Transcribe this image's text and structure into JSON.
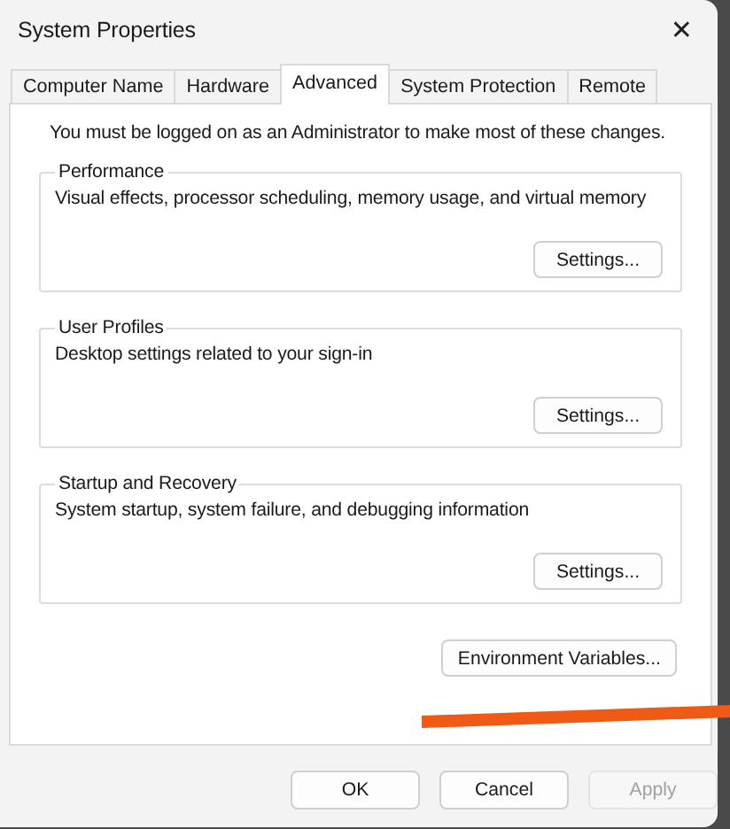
{
  "window": {
    "title": "System Properties",
    "close": "✕"
  },
  "tabs": [
    {
      "label": "Computer Name",
      "selected": false
    },
    {
      "label": "Hardware",
      "selected": false
    },
    {
      "label": "Advanced",
      "selected": true
    },
    {
      "label": "System Protection",
      "selected": false
    },
    {
      "label": "Remote",
      "selected": false
    }
  ],
  "notice": "You must be logged on as an Administrator to make most of these changes.",
  "groups": [
    {
      "title": "Performance",
      "description": "Visual effects, processor scheduling, memory usage, and virtual memory",
      "button": "Settings..."
    },
    {
      "title": "User Profiles",
      "description": "Desktop settings related to your sign-in",
      "button": "Settings..."
    },
    {
      "title": "Startup and Recovery",
      "description": "System startup, system failure, and debugging information",
      "button": "Settings..."
    }
  ],
  "environment_button": "Environment Variables...",
  "buttons": [
    {
      "label": "OK",
      "disabled": false
    },
    {
      "label": "Cancel",
      "disabled": false
    },
    {
      "label": "Apply",
      "disabled": true
    }
  ]
}
